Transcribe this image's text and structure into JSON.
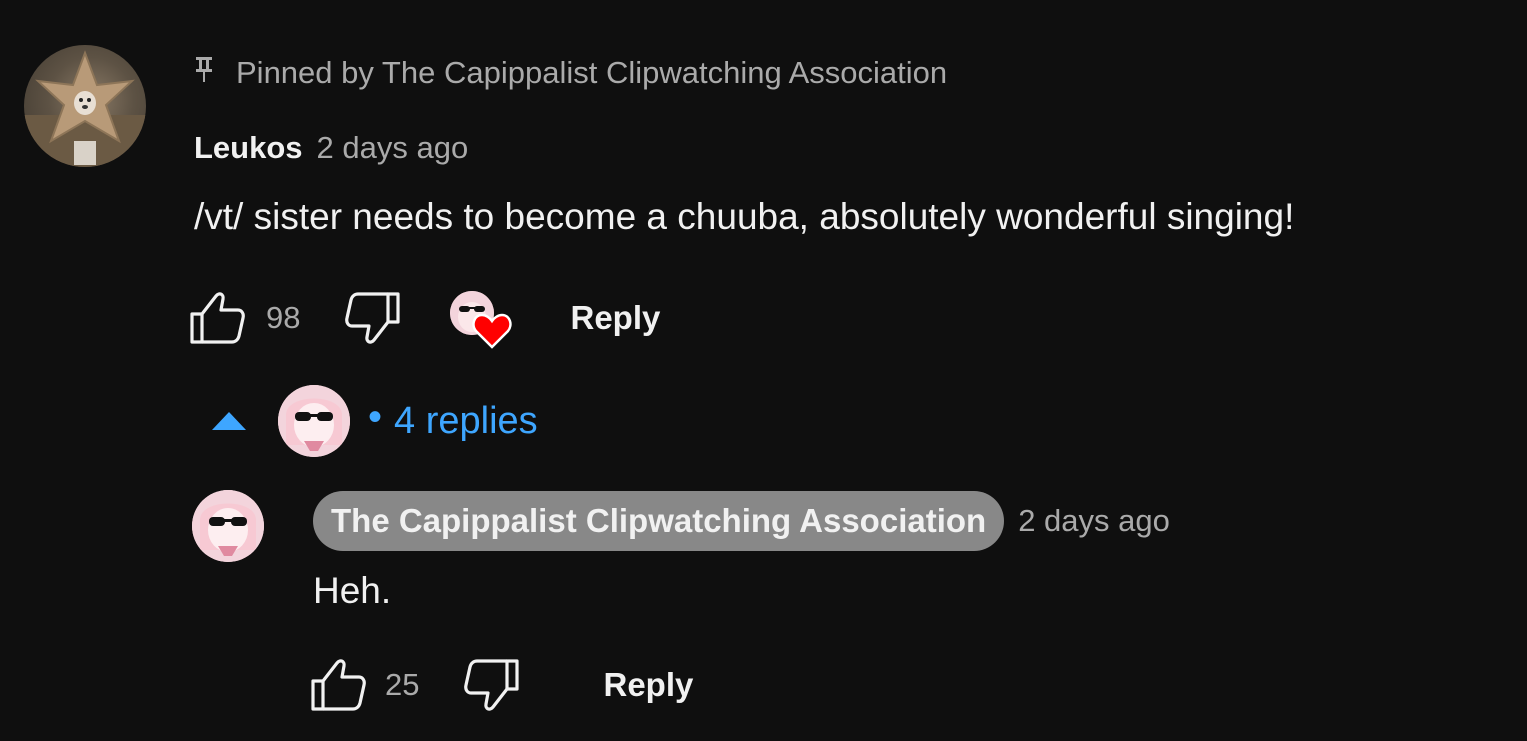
{
  "comment": {
    "pinned_label": "Pinned by The Capippalist Clipwatching Association",
    "author": "Leukos",
    "time": "2 days ago",
    "text": "/vt/ sister needs to become a chuuba, absolutely wonderful singing!",
    "like_count": "98",
    "reply_label": "Reply",
    "avatar_icon": "star-mask-dog-avatar",
    "creator_heart_icon": "creator-heart-icon"
  },
  "replies_toggle": {
    "dot": "•",
    "label": "4 replies",
    "accent_color": "#3ea6ff"
  },
  "reply": {
    "author": "The Capippalist Clipwatching Association",
    "time": "2 days ago",
    "text": "Heh.",
    "like_count": "25",
    "reply_label": "Reply",
    "avatar_icon": "anime-girl-sunglasses-avatar"
  },
  "colors": {
    "background": "#0f0f0f",
    "primary_text": "#f1f1f1",
    "secondary_text": "#aaaaaa",
    "owner_badge": "#888888",
    "heart": "#ff0000"
  }
}
